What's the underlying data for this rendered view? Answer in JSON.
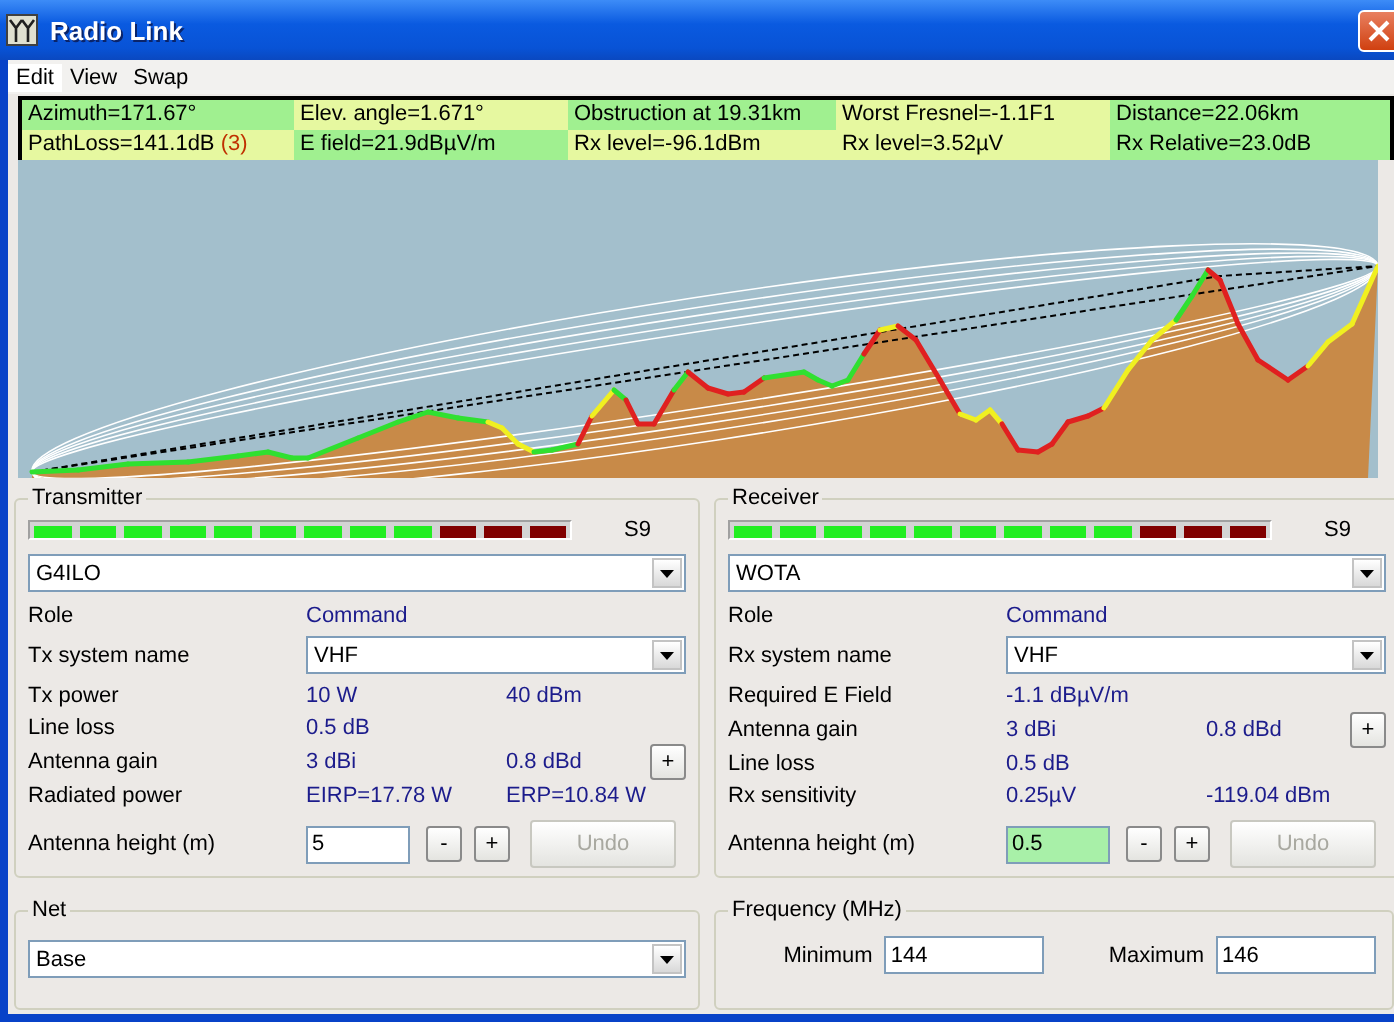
{
  "window": {
    "title": "Radio Link"
  },
  "menu": [
    {
      "label": "Edit",
      "selected": true
    },
    {
      "label": "View",
      "selected": false
    },
    {
      "label": "Swap",
      "selected": false
    }
  ],
  "results": [
    [
      {
        "text": "Azimuth=171.67°",
        "color": "#a0f090"
      },
      {
        "text": "Elev. angle=1.671°",
        "color": "#e6f8a0"
      },
      {
        "text": "Obstruction at 19.31km",
        "color": "#a0f090"
      },
      {
        "text": "Worst Fresnel=-1.1F1",
        "color": "#e6f8a0"
      },
      {
        "text": "Distance=22.06km",
        "color": "#a0f090"
      }
    ],
    [
      {
        "text": "PathLoss=141.1dB",
        "note": "(3)",
        "color": "#e6f8a0"
      },
      {
        "text": "E field=21.9dBµV/m",
        "color": "#a0f090"
      },
      {
        "text": "Rx level=-96.1dBm",
        "color": "#e6f8a0"
      },
      {
        "text": "Rx level=3.52µV",
        "color": "#e6f8a0"
      },
      {
        "text": "Rx Relative=23.0dB",
        "color": "#a0f090"
      }
    ]
  ],
  "transmitter": {
    "title": "Transmitter",
    "meter": {
      "level": 1,
      "reading": "S9"
    },
    "station": "G4ILO",
    "rows": [
      {
        "kind": "text",
        "label": "Role",
        "values": [
          "Command"
        ]
      },
      {
        "kind": "select",
        "label": "Tx system name",
        "value": "VHF"
      },
      {
        "kind": "text",
        "label": "Tx power",
        "values": [
          "10 W",
          "40 dBm"
        ]
      },
      {
        "kind": "text",
        "label": "Line loss",
        "values": [
          "0.5 dB"
        ]
      },
      {
        "kind": "text",
        "label": "Antenna gain",
        "values": [
          "3 dBi",
          "0.8 dBd"
        ],
        "button": "+"
      },
      {
        "kind": "text",
        "label": "Radiated power",
        "values": [
          "EIRP=17.78 W",
          "ERP=10.84 W"
        ]
      },
      {
        "kind": "height",
        "label": "Antenna height (m)",
        "value": "5",
        "highlighted": false,
        "buttons": [
          {
            "label": "-",
            "disabled": false
          },
          {
            "label": "+",
            "disabled": false
          },
          {
            "label": "Undo",
            "disabled": true
          }
        ]
      }
    ]
  },
  "receiver": {
    "title": "Receiver",
    "meter": {
      "level": 1,
      "reading": "S9"
    },
    "station": "WOTA",
    "rows": [
      {
        "kind": "text",
        "label": "Role",
        "values": [
          "Command"
        ]
      },
      {
        "kind": "select",
        "label": "Rx system name",
        "value": "VHF"
      },
      {
        "kind": "text",
        "label": "Required E Field",
        "values": [
          "-1.1 dBµV/m"
        ]
      },
      {
        "kind": "text",
        "label": "Antenna gain",
        "values": [
          "3 dBi",
          "0.8 dBd"
        ],
        "button": "+"
      },
      {
        "kind": "text",
        "label": "Line loss",
        "values": [
          "0.5 dB"
        ]
      },
      {
        "kind": "text",
        "label": "Rx sensitivity",
        "values": [
          "0.25µV",
          "-119.04 dBm"
        ]
      },
      {
        "kind": "height",
        "label": "Antenna height (m)",
        "value": "0.5",
        "highlighted": true,
        "buttons": [
          {
            "label": "-",
            "disabled": false
          },
          {
            "label": "+",
            "disabled": false
          },
          {
            "label": "Undo",
            "disabled": true
          }
        ]
      }
    ]
  },
  "net": {
    "title": "Net",
    "value": "Base"
  },
  "frequency": {
    "title": "Frequency (MHz)",
    "fields": [
      {
        "label": "Minimum",
        "value": "144"
      },
      {
        "label": "Maximum",
        "value": "146"
      }
    ]
  }
}
